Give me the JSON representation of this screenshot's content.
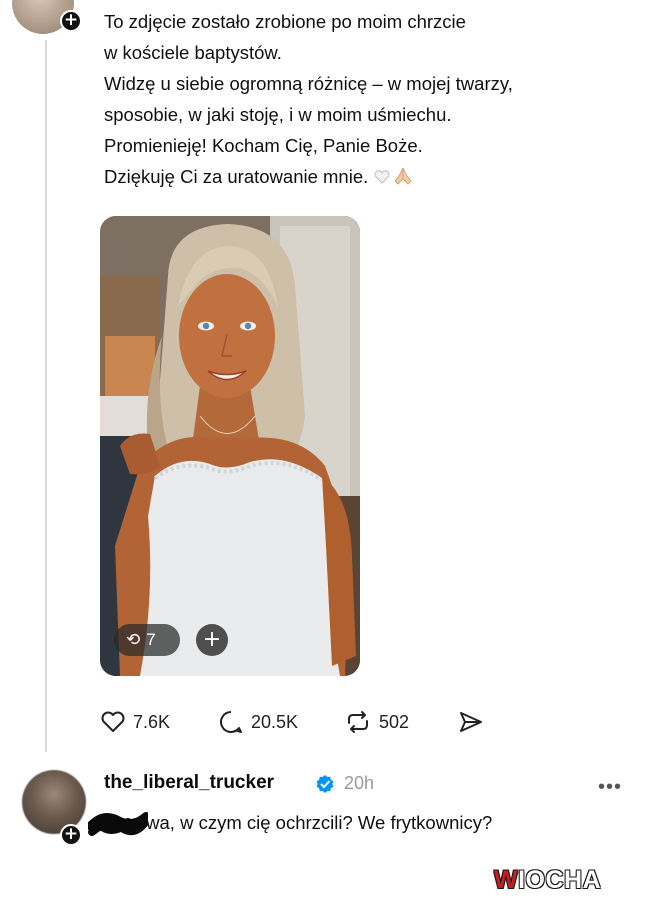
{
  "post": {
    "lines": [
      "To zdjęcie zostało zrobione po moim chrzcie",
      "w kościele baptystów.",
      "Widzę u siebie ogromną różnicę – w mojej twarzy,",
      "sposobie, w jaki stoję, i w moim uśmiechu.",
      "Promienieję! Kocham Cię, Panie Boże.",
      "Dziękuję Ci za uratowanie mnie."
    ],
    "emojis": [
      "white-heart-icon",
      "folded-hands-icon"
    ],
    "photo": {
      "repost_count": "7"
    },
    "actions": {
      "likes": "7.6K",
      "comments": "20.5K",
      "reposts": "502"
    }
  },
  "reply": {
    "username": "the_liberal_trucker",
    "time": "20h",
    "more": "•••",
    "text": "rwa, w czym cię ochrzcili? We frytkownicy?"
  },
  "watermark": {
    "prefix": "W",
    "rest": "IOCHA"
  },
  "colors": {
    "verified": "#0095f6",
    "watermark_red": "#c61f1f",
    "thread_line": "#d8d8d8"
  }
}
